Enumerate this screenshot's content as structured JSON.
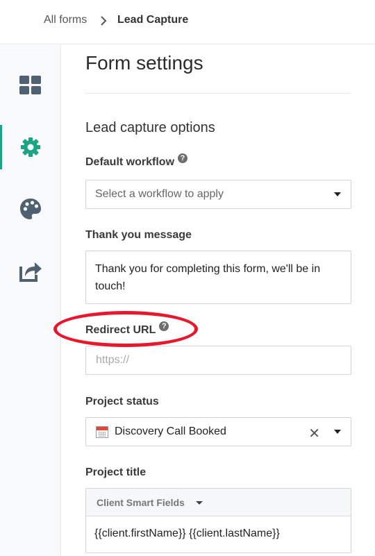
{
  "breadcrumb": {
    "parent": "All forms",
    "current": "Lead Capture"
  },
  "sidebar": {
    "items": [
      {
        "icon": "grid-icon",
        "active": false
      },
      {
        "icon": "gear-icon",
        "active": true
      },
      {
        "icon": "palette-icon",
        "active": false
      },
      {
        "icon": "share-icon",
        "active": false
      }
    ]
  },
  "page": {
    "title": "Form settings",
    "section": "Lead capture options"
  },
  "workflow": {
    "label": "Default workflow",
    "placeholder": "Select a workflow to apply"
  },
  "thank_you": {
    "label": "Thank you message",
    "value": "Thank you for completing this form, we'll be in touch!"
  },
  "redirect": {
    "label": "Redirect URL",
    "placeholder": "https://"
  },
  "project_status": {
    "label": "Project status",
    "value": "Discovery Call Booked",
    "clear": "✕"
  },
  "project_title": {
    "label": "Project title",
    "smart_fields": "Client Smart Fields",
    "value": "{{client.firstName}} {{client.lastName}}"
  },
  "help_glyph": "?",
  "colors": {
    "accent": "#1ba486",
    "annotation": "#e8172b"
  }
}
